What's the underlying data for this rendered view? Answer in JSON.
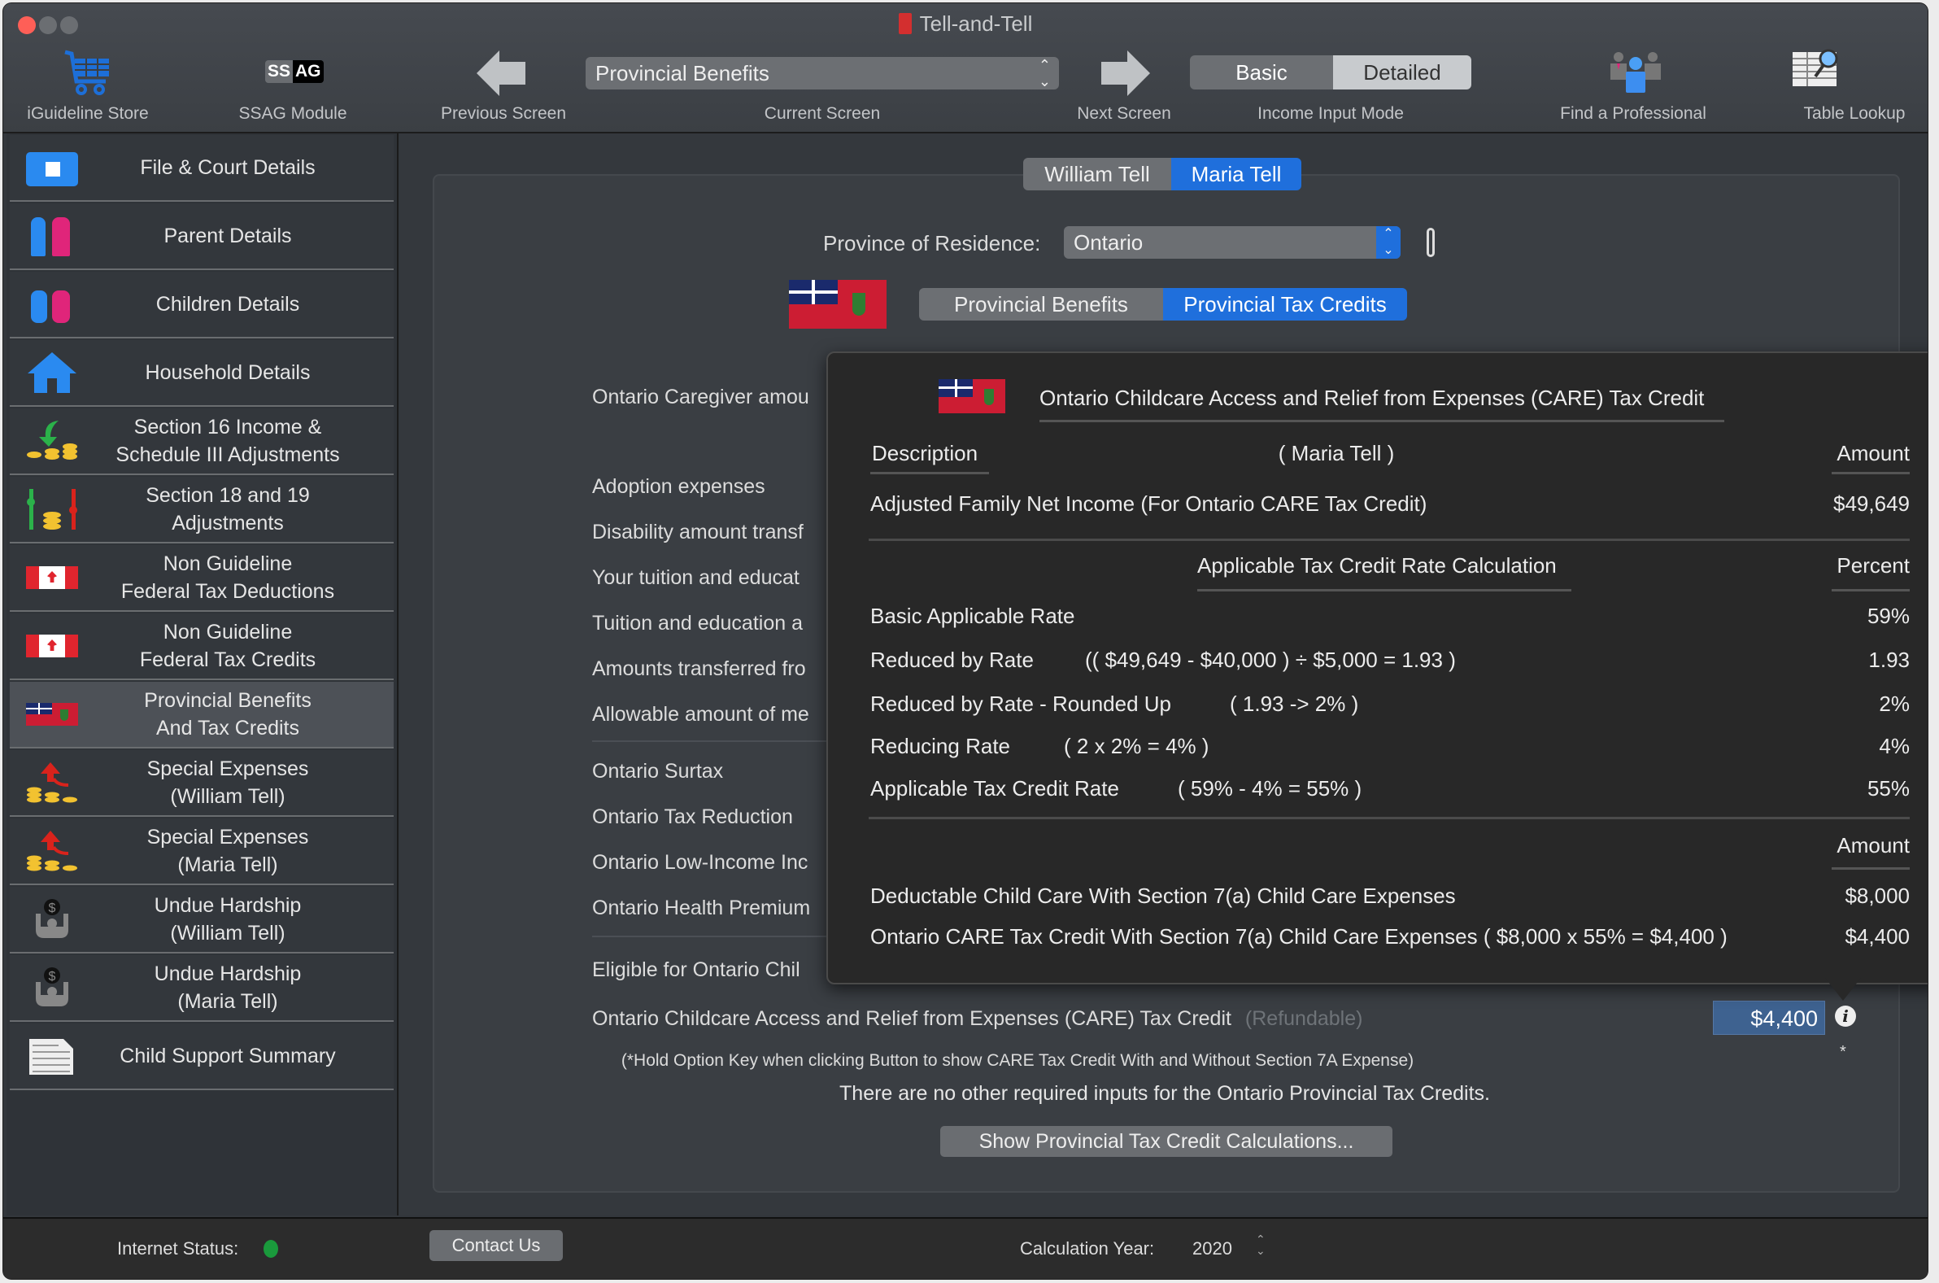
{
  "window": {
    "title": "Tell-and-Tell"
  },
  "toolbar": {
    "store_label": "iGuideline Store",
    "ssag_label": "SSAG Module",
    "ssag_badge_left": "SS",
    "ssag_badge_right": "AG",
    "previous_label": "Previous Screen",
    "current_screen_value": "Provincial Benefits",
    "current_screen_label": "Current Screen",
    "next_label": "Next Screen",
    "income_mode": {
      "options": [
        "Basic",
        "Detailed"
      ],
      "selected": "Detailed",
      "label": "Income Input Mode"
    },
    "find_professional_label": "Find a Professional",
    "table_lookup_label": "Table Lookup"
  },
  "sidebar": {
    "items": [
      {
        "label": "File & Court Details",
        "icon": "court-folder-icon"
      },
      {
        "label": "Parent Details",
        "icon": "parents-icon"
      },
      {
        "label": "Children Details",
        "icon": "children-icon"
      },
      {
        "label": "Household Details",
        "icon": "house-icon"
      },
      {
        "label": "Section 16 Income &\nSchedule III Adjustments",
        "icon": "income-coins-icon"
      },
      {
        "label": "Section 18 and 19\nAdjustments",
        "icon": "adjustment-sliders-icon"
      },
      {
        "label": "Non Guideline\nFederal Tax Deductions",
        "icon": "canada-flag-icon"
      },
      {
        "label": "Non Guideline\nFederal Tax Credits",
        "icon": "canada-flag-icon"
      },
      {
        "label": "Provincial Benefits\nAnd Tax Credits",
        "icon": "ontario-flag-icon",
        "active": true
      },
      {
        "label": "Special Expenses\n(William Tell)",
        "icon": "expenses-up-icon"
      },
      {
        "label": "Special Expenses\n(Maria Tell)",
        "icon": "expenses-up-icon"
      },
      {
        "label": "Undue Hardship\n(William Tell)",
        "icon": "hardship-icon"
      },
      {
        "label": "Undue Hardship\n(Maria Tell)",
        "icon": "hardship-icon"
      },
      {
        "label": "Child Support Summary",
        "icon": "summary-sheet-icon"
      }
    ]
  },
  "main": {
    "parent_tabs": {
      "options": [
        "William Tell",
        "Maria Tell"
      ],
      "selected": "Maria Tell"
    },
    "province_label": "Province of Residence:",
    "province_value": "Ontario",
    "section_tabs": {
      "options": [
        "Provincial Benefits",
        "Provincial Tax Credits"
      ],
      "selected": "Provincial Tax Credits"
    },
    "rows": [
      "Ontario Caregiver amou",
      "Adoption expenses",
      "Disability amount transf",
      "Your tuition and educat",
      "Tuition and education a",
      "Amounts transferred fro",
      "Allowable amount of me",
      "Ontario Surtax",
      "Ontario Tax Reduction",
      "Ontario Low-Income Inc",
      "Ontario Health Premium",
      "Eligible for Ontario Chil"
    ],
    "care_credit_label": "Ontario Childcare Access and Relief from Expenses (CARE) Tax Credit",
    "care_credit_note": "(Refundable)",
    "care_credit_value": "$4,400",
    "asterisk": "*",
    "option_key_note": "(*Hold Option Key when clicking Button to show CARE Tax Credit With and Without Section 7A Expense)",
    "no_inputs_note": "There are no other required inputs for the Ontario Provincial Tax Credits.",
    "show_calc_button": "Show Provincial Tax Credit Calculations..."
  },
  "popover": {
    "title": "Ontario Childcare Access and Relief from Expenses (CARE) Tax Credit",
    "col_description": "Description",
    "person": "( Maria Tell )",
    "col_amount": "Amount",
    "adjusted_income_label": "Adjusted Family Net Income (For Ontario CARE Tax Credit)",
    "adjusted_income_value": "$49,649",
    "rate_section_title": "Applicable Tax Credit Rate Calculation",
    "col_percent": "Percent",
    "rate_rows": [
      {
        "label": "Basic Applicable Rate",
        "formula": "",
        "value": "59%"
      },
      {
        "label": "Reduced by Rate",
        "formula": "(( $49,649 - $40,000 ) ÷ $5,000 = 1.93 )",
        "value": "1.93"
      },
      {
        "label": "Reduced by Rate - Rounded Up",
        "formula": "( 1.93 -> 2% )",
        "value": "2%"
      },
      {
        "label": "Reducing Rate",
        "formula": "( 2 x 2% = 4% )",
        "value": "4%"
      },
      {
        "label": "Applicable Tax Credit Rate",
        "formula": "( 59% - 4% = 55% )",
        "value": "55%"
      }
    ],
    "col_amount2": "Amount",
    "amount_rows": [
      {
        "label": "Deductable Child Care With Section 7(a) Child Care Expenses",
        "value": "$8,000"
      },
      {
        "label": "Ontario CARE Tax Credit With Section 7(a) Child Care Expenses  ( $8,000 x 55% = $4,400 )",
        "value": "$4,400"
      }
    ]
  },
  "footer": {
    "internet_status_label": "Internet Status:",
    "internet_status_color": "#1a9a3c",
    "contact_button": "Contact Us",
    "calc_year_label": "Calculation Year:",
    "calc_year_value": "2020"
  },
  "colors": {
    "accent": "#1f6fdc",
    "ontario_red": "#cc1d33",
    "value_field": "#3e6290"
  }
}
